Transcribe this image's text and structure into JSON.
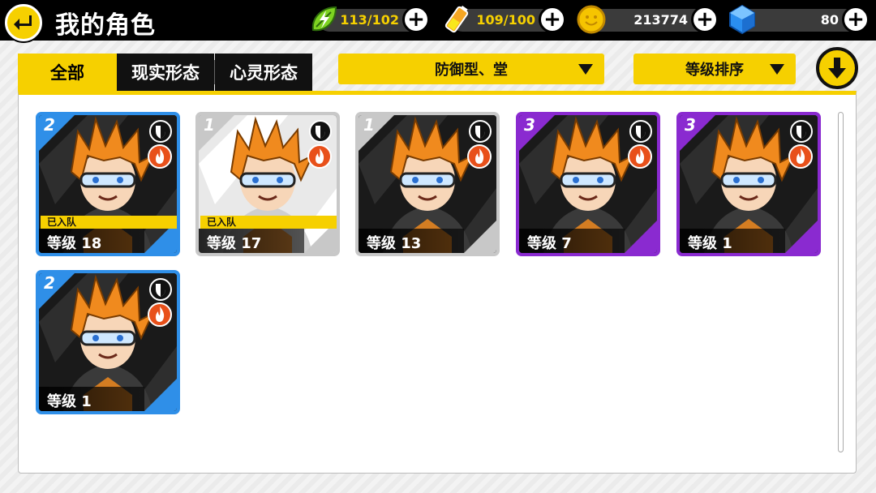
{
  "header": {
    "title": "我的角色",
    "resources": [
      {
        "name": "energy",
        "icon": "leaf-energy-icon",
        "value": "113/102"
      },
      {
        "name": "stamina",
        "icon": "battery-icon",
        "value": "109/100"
      },
      {
        "name": "gold",
        "icon": "coin-icon",
        "value": "213774"
      },
      {
        "name": "gems",
        "icon": "crystal-icon",
        "value": "80"
      }
    ]
  },
  "filters": {
    "tabs": [
      {
        "label": "全部",
        "active": true
      },
      {
        "label": "现实形态",
        "active": false
      },
      {
        "label": "心灵形态",
        "active": false
      }
    ],
    "type_filter": "防御型、堂",
    "sort": "等级排序"
  },
  "characters": [
    {
      "rank": "2",
      "frame": "blue",
      "in_team": "已入队",
      "level": "等级 18",
      "bg": "dark"
    },
    {
      "rank": "1",
      "frame": "gray",
      "in_team": "已入队",
      "level": "等级 17",
      "bg": "light"
    },
    {
      "rank": "1",
      "frame": "gray",
      "in_team": "",
      "level": "等级 13",
      "bg": "dark"
    },
    {
      "rank": "3",
      "frame": "purple",
      "in_team": "",
      "level": "等级 7",
      "bg": "dark"
    },
    {
      "rank": "3",
      "frame": "purple",
      "in_team": "",
      "level": "等级 1",
      "bg": "dark"
    },
    {
      "rank": "2",
      "frame": "blue",
      "in_team": "",
      "level": "等级 1",
      "bg": "dark"
    }
  ],
  "colors": {
    "accent": "#f6d000",
    "rank_blue": "#2f8fe8",
    "rank_gray": "#c8c8c8",
    "rank_purple": "#8a2ad0",
    "hair": "#f08a1e"
  }
}
